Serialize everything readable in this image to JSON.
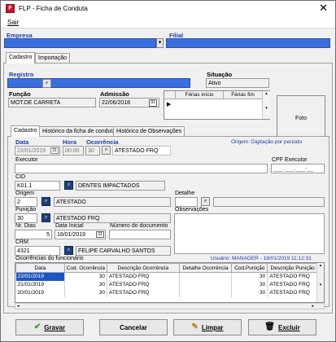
{
  "window": {
    "title": "FLP - Ficha de Conduta",
    "close_glyph": "✕"
  },
  "menu": {
    "sair": "Sair"
  },
  "top": {
    "empresa_label": "Empresa",
    "filial_label": "Filial",
    "empresa_dropdown_glyph": "▾"
  },
  "main_tabs": [
    "Cadastro",
    "Importação"
  ],
  "registro": {
    "label": "Registro",
    "value": ""
  },
  "situacao": {
    "label": "Situação",
    "value": "Ativo"
  },
  "funcao": {
    "label": "Função",
    "value": "MOT.DE CARRETA"
  },
  "admissao": {
    "label": "Admissão",
    "value": "22/06/2018"
  },
  "ferias": {
    "col1": "Férias início",
    "col2": "Férias fim"
  },
  "foto_label": "Foto",
  "sub_tabs": [
    "Cadastro",
    "Histórico da ficha de conduta",
    "Histórico de Observações"
  ],
  "form": {
    "data_label": "Data",
    "hora_label": "Hora",
    "ocorrencia_label": "Ocorrência",
    "origem_text": "Origem: Digitação por período",
    "data_value": "22/01/2019",
    "hora_value": "00:00",
    "ocorrencia_code": "30",
    "ocorrencia_desc": "ATESTADO FRQ",
    "executor_label": "Executor",
    "cpf_label": "CPF Executor",
    "cpf_value": "___.___.___-__",
    "cid_label": "CID",
    "cid_code": "K01.1",
    "cid_desc": "DENTES IMPACTADOS",
    "origem_label": "Origem",
    "origem_code": "2",
    "origem_desc": "ATESTADO",
    "detalhe_label": "Detalhe",
    "punicao_label": "Punição",
    "punicao_code": "30",
    "punicao_desc": "ATESTADO FRQ",
    "observacoes_label": "Observações",
    "nr_dias_label": "Nr. Dias",
    "nr_dias_value": "5",
    "data_inicial_label": "Data Inicial",
    "data_inicial_value": "18/01/2019",
    "num_doc_label": "Número do documento",
    "crm_label": "CRM",
    "crm_code": "4321",
    "crm_name": "FELIPE CARVALHO SANTOS",
    "ocorrencias_label": "Ocorrências do funcionário",
    "usuario_text": "Usuário: MANAGER - 18/01/2019 11:12:31"
  },
  "grid": {
    "headers": [
      "Data",
      "Cod. Ocorrência",
      "Descrição Ocorrência",
      "Detalhe Ocorrência",
      "Cod.Punição",
      "Descrição Punição"
    ],
    "rows": [
      [
        "22/01/2019",
        "30",
        "ATESTADO FRQ",
        "",
        "30",
        "ATESTADO FRQ"
      ],
      [
        "21/01/2019",
        "30",
        "ATESTADO FRQ",
        "",
        "30",
        "ATESTADO FRQ"
      ],
      [
        "20/01/2019",
        "30",
        "ATESTADO FRQ",
        "",
        "30",
        "ATESTADO FRQ"
      ]
    ]
  },
  "buttons": {
    "gravar": "Gravar",
    "cancelar": "Cancelar",
    "limpar": "Limpar",
    "excluir": "Excluir"
  },
  "colors": {
    "accent_blue": "#3a6fe0",
    "label_blue": "#1a3da8",
    "selection": "#1b57c4",
    "check_green": "#2e9a2e"
  }
}
